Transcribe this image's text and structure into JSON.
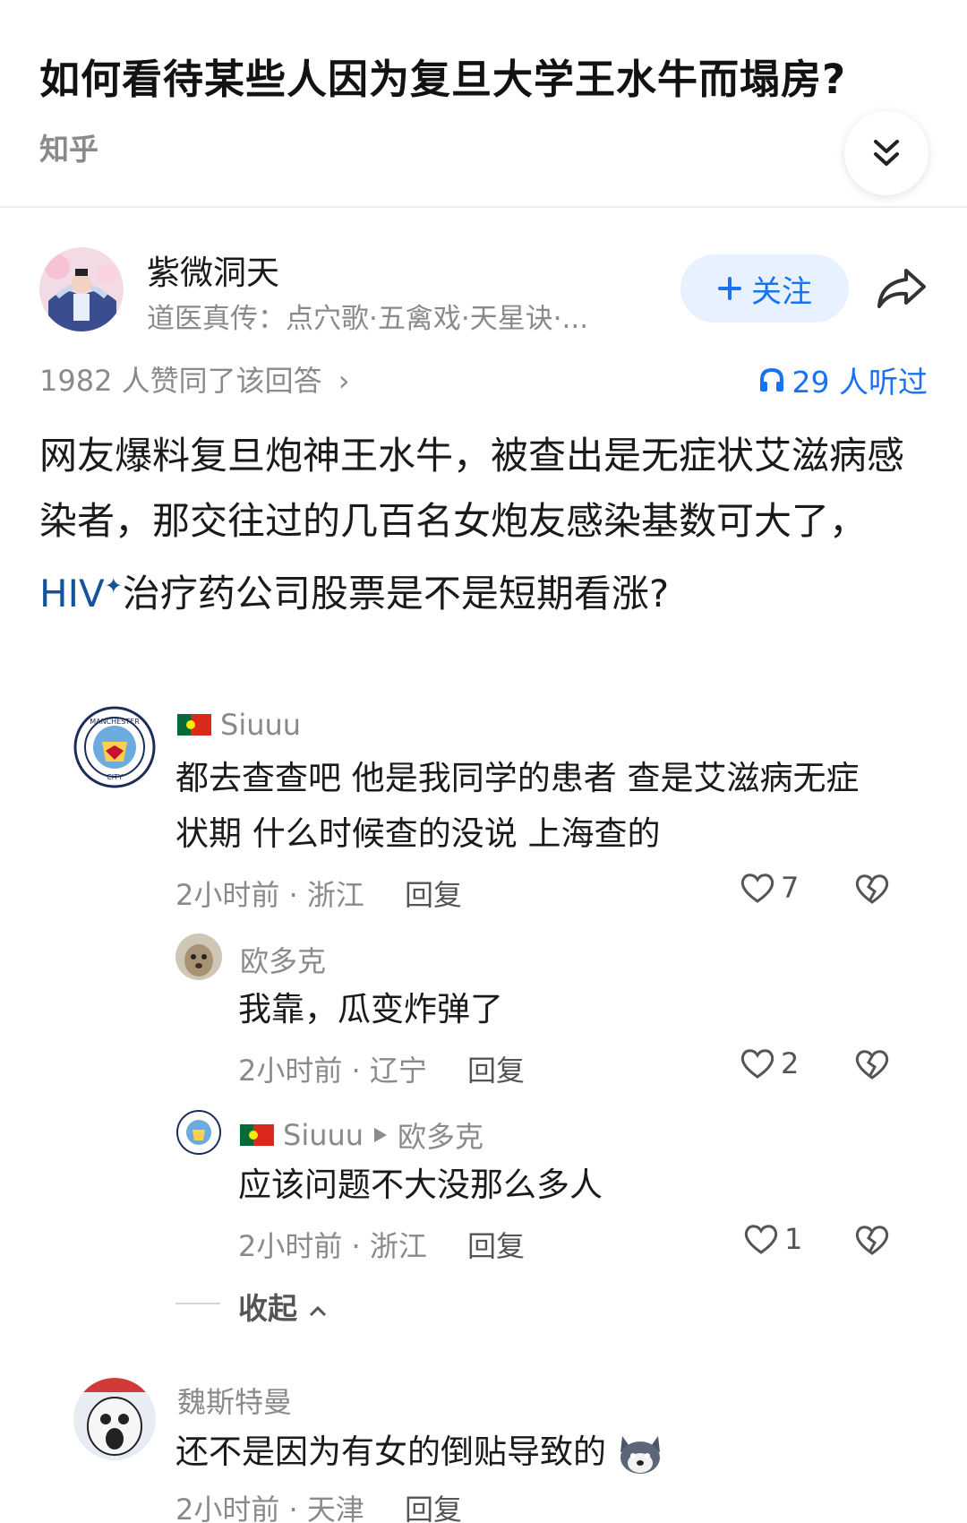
{
  "question": {
    "title": "如何看待某些人因为复旦大学王水牛而塌房?",
    "source": "知乎"
  },
  "author": {
    "name": "紫微洞天",
    "bio": "道医真传：点穴歌·五禽戏·天星诀·...",
    "follow_label": "关注",
    "follow_icon": "plus-icon",
    "share_icon": "share-arrow-icon"
  },
  "stats": {
    "votes_text": "1982 人赞同了该回答",
    "listened_text": "29 人听过"
  },
  "answer": {
    "part1": "网友爆料复旦炮神王水牛，被查出是无症状艾滋病感染者，那交往过的几百名女炮友感染基数可大了，",
    "link": "HIV",
    "link_mark": "✦",
    "part2": "治疗药公司股票是不是短期看涨?"
  },
  "comments": [
    {
      "user": "Siuuu",
      "text": "都去查查吧 他是我同学的患者 查是艾滋病无症状期 什么时候查的没说 上海查的",
      "time": "2小时前 · 浙江",
      "reply_label": "回复",
      "likes": "7"
    },
    {
      "user": "欧多克",
      "text": "我靠，瓜变炸弹了",
      "time": "2小时前 · 辽宁",
      "reply_label": "回复",
      "likes": "2"
    },
    {
      "user": "Siuuu",
      "reply_to": "欧多克",
      "text": "应该问题不大没那么多人",
      "time": "2小时前 · 浙江",
      "reply_label": "回复",
      "likes": "1"
    },
    {
      "user": "魏斯特曼",
      "text": "还不是因为有女的倒贴导致的",
      "time": "2小时前 · 天津",
      "reply_label": "回复"
    }
  ],
  "collapse_label": "收起",
  "colors": {
    "accent": "#1772f6",
    "link": "#175199",
    "muted": "#8a8a8a"
  }
}
